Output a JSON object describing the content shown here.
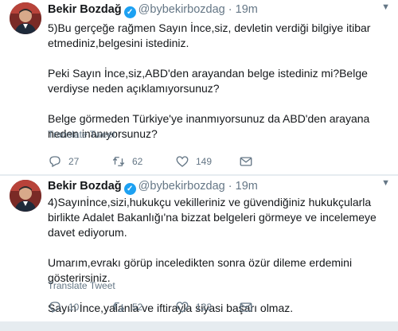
{
  "tweets": [
    {
      "name": "Bekir Bozdağ",
      "handle": "@bybekirbozdag",
      "separator": "·",
      "time": "19m",
      "paragraphs": [
        "5)Bu gerçeğe rağmen Sayın İnce,siz, devletin verdiği bilgiye itibar etmediniz,belgesini istediniz.",
        "Peki Sayın İnce,siz,ABD'den arayandan belge istediniz mi?Belge verdiyse neden açıklamıyorsunuz?",
        "Belge görmeden Türkiye'ye inanmıyorsunuz da ABD'den arayana neden inanıyorsunuz?"
      ],
      "translate_label": "Translate Tweet",
      "reply_count": "27",
      "retweet_count": "62",
      "like_count": "149"
    },
    {
      "name": "Bekir Bozdağ",
      "handle": "@bybekirbozdag",
      "separator": "·",
      "time": "19m",
      "paragraphs": [
        "4)Sayınİnce,sizi,hukukçu vekilleriniz ve güvendiğiniz hukukçularla birlikte Adalet Bakanlığı'na bizzat belgeleri görmeye ve incelemeye davet ediyorum.",
        "Umarım,evrakı görüp inceledikten sonra özür dileme erdemini gösterirsiniz.",
        "Sayın İnce,yalanla ve iftirayla siyasi başarı olmaz."
      ],
      "translate_label": "Translate Tweet",
      "reply_count": "10",
      "retweet_count": "52",
      "like_count": "122"
    }
  ],
  "colors": {
    "background": "#e6ecf0",
    "card": "#ffffff",
    "text": "#14171a",
    "muted": "#657786",
    "verified": "#1da1f2"
  },
  "icons": [
    "verified-badge-icon",
    "reply-icon",
    "retweet-icon",
    "like-icon",
    "direct-message-icon",
    "chevron-down-icon"
  ]
}
